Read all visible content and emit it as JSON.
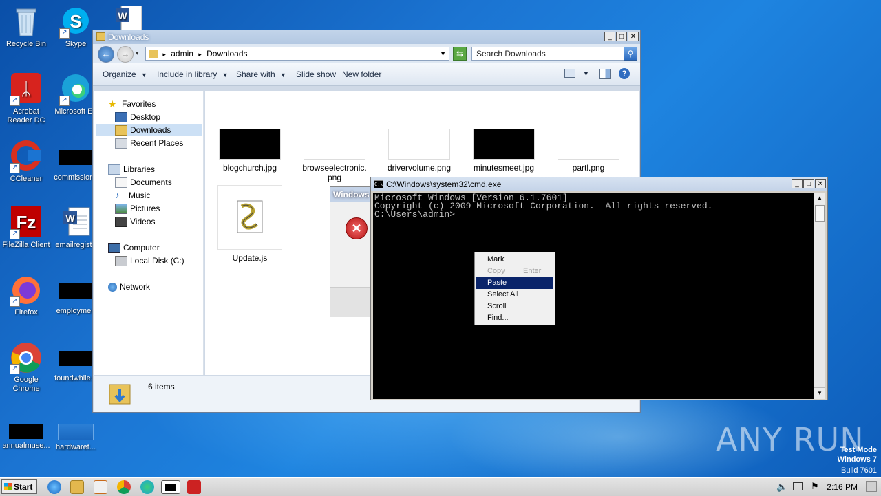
{
  "desktop": {
    "icons": [
      {
        "label": "Recycle Bin"
      },
      {
        "label": "Skype"
      },
      {
        "label": "Acrobat Reader DC"
      },
      {
        "label": "Microsoft Ed"
      },
      {
        "label": "CCleaner"
      },
      {
        "label": "commissionc"
      },
      {
        "label": "FileZilla Client"
      },
      {
        "label": "emailregist.."
      },
      {
        "label": "Firefox"
      },
      {
        "label": "employmen"
      },
      {
        "label": "Google Chrome"
      },
      {
        "label": "foundwhile..."
      },
      {
        "label": "annualmuse..."
      },
      {
        "label": "hardwaret..."
      }
    ]
  },
  "explorer": {
    "title": "Downloads",
    "breadcrumb": [
      "admin",
      "Downloads"
    ],
    "search_placeholder": "Search Downloads",
    "toolbar": {
      "organize": "Organize",
      "include_in_library": "Include in library",
      "share_with": "Share with",
      "slide_show": "Slide show",
      "new_folder": "New folder"
    },
    "nav": {
      "favorites": "Favorites",
      "desktop": "Desktop",
      "downloads": "Downloads",
      "recent_places": "Recent Places",
      "libraries": "Libraries",
      "documents": "Documents",
      "music": "Music",
      "pictures": "Pictures",
      "videos": "Videos",
      "computer": "Computer",
      "local_disk": "Local Disk (C:)",
      "network": "Network"
    },
    "files": [
      {
        "name": "blogchurch.jpg"
      },
      {
        "name": "browseelectronic.png"
      },
      {
        "name": "drivervolume.png"
      },
      {
        "name": "minutesmeet.jpg"
      },
      {
        "name": "partl.png"
      },
      {
        "name": "Update.js"
      }
    ],
    "status": "6 items"
  },
  "error_dialog": {
    "title": "Windows"
  },
  "cmd": {
    "title": "C:\\Windows\\system32\\cmd.exe",
    "lines": [
      "Microsoft Windows [Version 6.1.7601]",
      "Copyright (c) 2009 Microsoft Corporation.  All rights reserved.",
      "",
      "C:\\Users\\admin>"
    ]
  },
  "context_menu": {
    "items": [
      {
        "label": "Mark",
        "shortcut": ""
      },
      {
        "label": "Copy",
        "shortcut": "Enter"
      },
      {
        "label": "Paste",
        "shortcut": ""
      },
      {
        "label": "Select All",
        "shortcut": ""
      },
      {
        "label": "Scroll",
        "shortcut": ""
      },
      {
        "label": "Find...",
        "shortcut": ""
      }
    ],
    "selected": "Paste",
    "disabled": "Copy"
  },
  "taskbar": {
    "start_label": "Start",
    "clock": "2:16 PM"
  },
  "watermark": {
    "brand": "ANY RUN",
    "test_mode": "Test Mode",
    "os": "Windows 7",
    "build": "Build 7601"
  },
  "colors": {
    "menu_highlight": "#0a246a",
    "desktop_blue": "#1b74d2",
    "console_bg": "#000000"
  }
}
